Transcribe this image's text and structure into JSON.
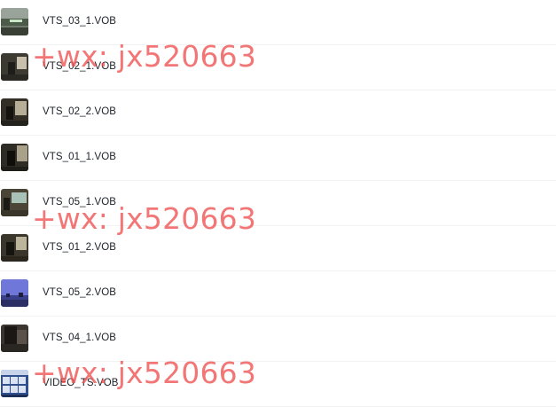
{
  "files": [
    {
      "name": "VTS_03_1.VOB",
      "thumb_icon": "video-thumbnail-icon"
    },
    {
      "name": "VTS_02_1.VOB",
      "thumb_icon": "video-thumbnail-icon"
    },
    {
      "name": "VTS_02_2.VOB",
      "thumb_icon": "video-thumbnail-icon"
    },
    {
      "name": "VTS_01_1.VOB",
      "thumb_icon": "video-thumbnail-icon"
    },
    {
      "name": "VTS_05_1.VOB",
      "thumb_icon": "video-thumbnail-icon"
    },
    {
      "name": "VTS_01_2.VOB",
      "thumb_icon": "video-thumbnail-icon"
    },
    {
      "name": "VTS_05_2.VOB",
      "thumb_icon": "video-thumbnail-icon"
    },
    {
      "name": "VTS_04_1.VOB",
      "thumb_icon": "video-thumbnail-icon"
    },
    {
      "name": "VIDEO_TS.VOB",
      "thumb_icon": "video-thumbnail-icon"
    }
  ],
  "watermark": {
    "text": "+wx: jx520663",
    "color": "#f05050"
  }
}
